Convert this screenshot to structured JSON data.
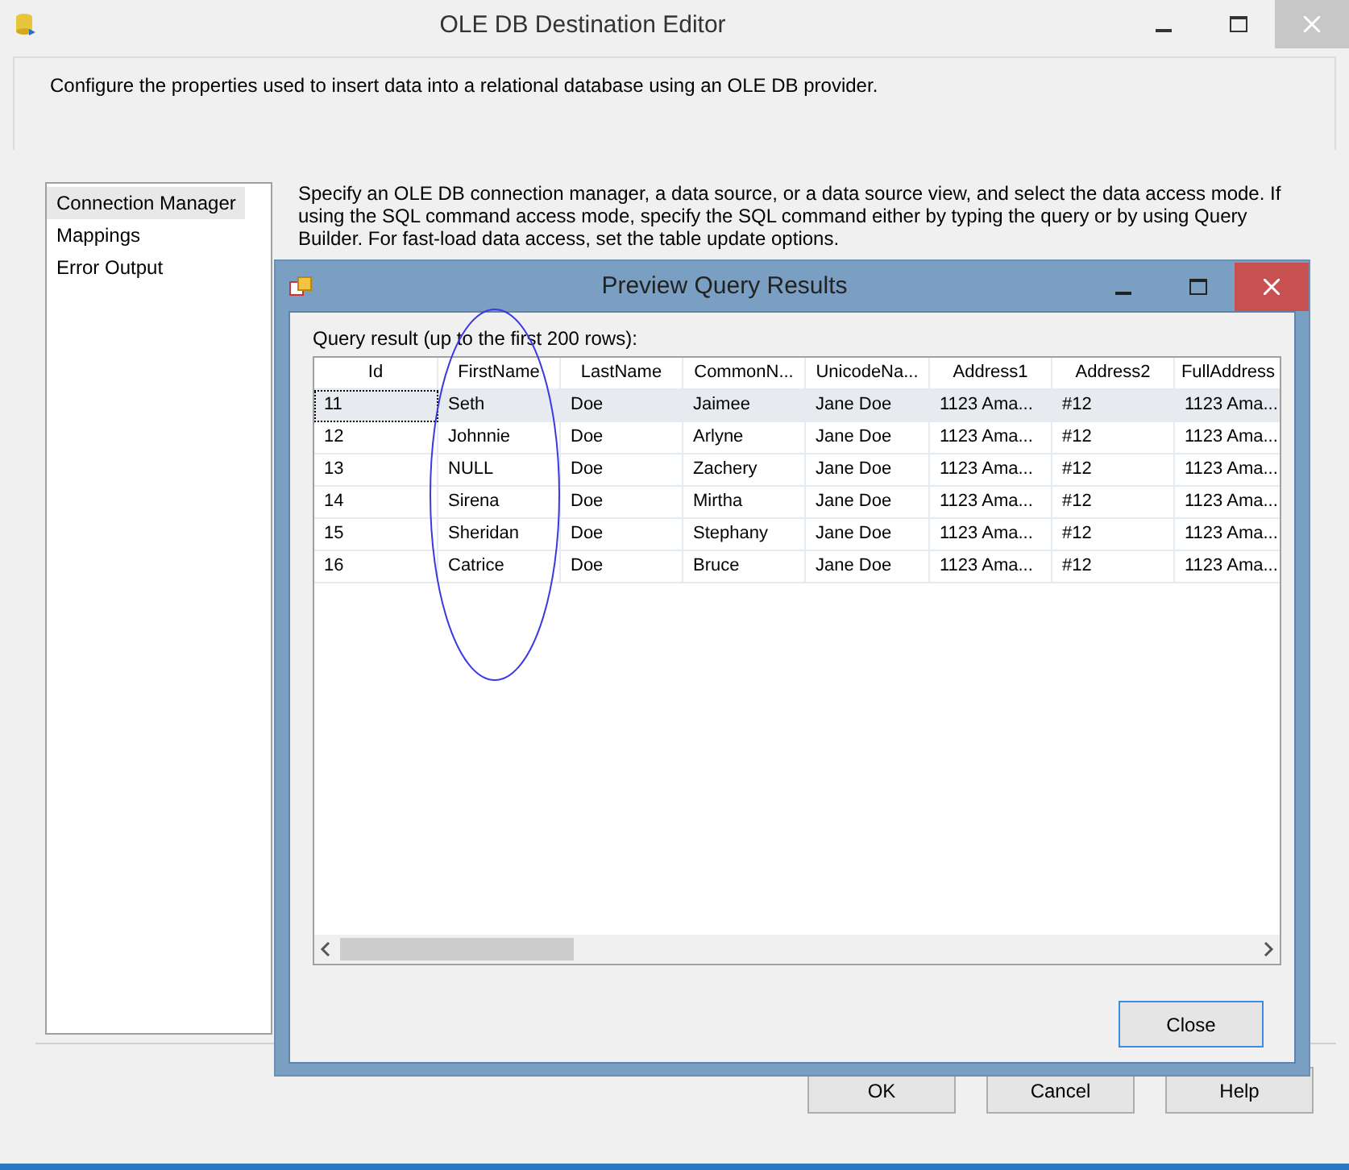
{
  "window": {
    "title": "OLE DB Destination Editor"
  },
  "header": {
    "text": "Configure the properties used to insert data into a relational database using an OLE DB provider."
  },
  "sidebar": {
    "items": [
      {
        "label": "Connection Manager",
        "selected": true
      },
      {
        "label": "Mappings",
        "selected": false
      },
      {
        "label": "Error Output",
        "selected": false
      }
    ]
  },
  "description": "Specify an OLE DB connection manager, a data source, or a data source view, and select the data access mode. If using the SQL command access mode, specify the SQL command either by typing the query or by using Query Builder. For fast-load data access, set the table update options.",
  "buttons": [
    "OK",
    "Cancel",
    "Help"
  ],
  "dialog": {
    "title": "Preview Query Results",
    "label": "Query result (up to the first 200 rows):",
    "table": {
      "columns": [
        "Id",
        "FirstName",
        "LastName",
        "CommonN...",
        "UnicodeNa...",
        "Address1",
        "Address2",
        "FullAddress"
      ],
      "rows": [
        {
          "selected": true,
          "cells": [
            "11",
            "Seth",
            "Doe",
            "Jaimee",
            "Jane Doe",
            "1123 Ama...",
            "#12",
            "1123 Ama..."
          ]
        },
        {
          "selected": false,
          "cells": [
            "12",
            "Johnnie",
            "Doe",
            "Arlyne",
            "Jane Doe",
            "1123 Ama...",
            "#12",
            "1123 Ama..."
          ]
        },
        {
          "selected": false,
          "cells": [
            "13",
            "NULL",
            "Doe",
            "Zachery",
            "Jane Doe",
            "1123 Ama...",
            "#12",
            "1123 Ama..."
          ]
        },
        {
          "selected": false,
          "cells": [
            "14",
            "Sirena",
            "Doe",
            "Mirtha",
            "Jane Doe",
            "1123 Ama...",
            "#12",
            "1123 Ama..."
          ]
        },
        {
          "selected": false,
          "cells": [
            "15",
            "Sheridan",
            "Doe",
            "Stephany",
            "Jane Doe",
            "1123 Ama...",
            "#12",
            "1123 Ama..."
          ]
        },
        {
          "selected": false,
          "cells": [
            "16",
            "Catrice",
            "Doe",
            "Bruce",
            "Jane Doe",
            "1123 Ama...",
            "#12",
            "1123 Ama..."
          ]
        }
      ]
    },
    "close_button": "Close"
  }
}
